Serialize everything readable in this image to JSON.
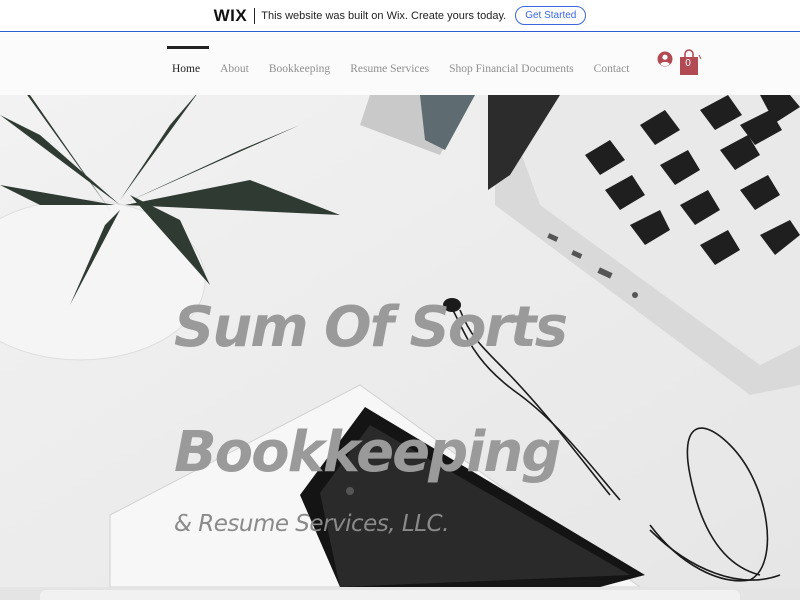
{
  "wix_banner": {
    "logo": "WIX",
    "message": "This website was built on Wix. Create yours today.",
    "cta_label": "Get Started",
    "accent_color": "#3a66e0"
  },
  "header": {
    "nav": [
      {
        "label": "Home",
        "active": true
      },
      {
        "label": "About",
        "active": false
      },
      {
        "label": "Bookkeeping",
        "active": false
      },
      {
        "label": "Resume Services",
        "active": false
      },
      {
        "label": "Shop Financial Documents",
        "active": false
      },
      {
        "label": "Contact",
        "active": false
      }
    ],
    "user_icon": "user-account-icon",
    "cart_icon": "shopping-bag-icon",
    "cart_count": "0",
    "cart_color": "#b14a52"
  },
  "hero": {
    "title_line1": "Sum Of Sorts",
    "title_line2": "Bookkeeping",
    "subtitle": "& Resume Services, LLC.",
    "title_color": "#9a9a9a"
  }
}
